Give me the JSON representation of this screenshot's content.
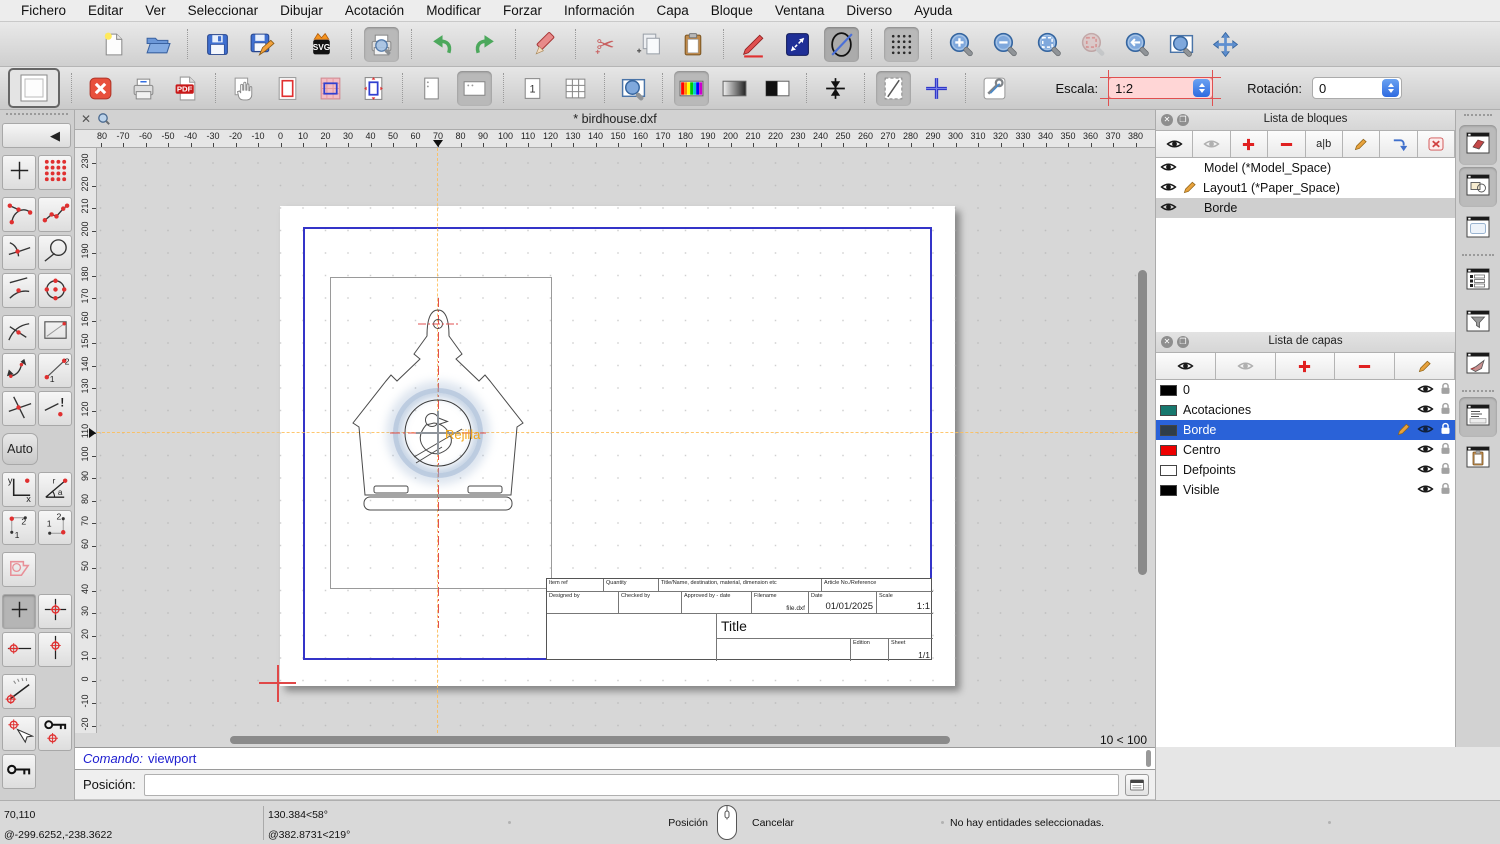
{
  "menu_bar": {
    "items": [
      "Fichero",
      "Editar",
      "Ver",
      "Seleccionar",
      "Dibujar",
      "Acotación",
      "Modificar",
      "Forzar",
      "Información",
      "Capa",
      "Bloque",
      "Ventana",
      "Diverso",
      "Ayuda"
    ]
  },
  "window": {
    "tab_title": "* birdhouse.dxf"
  },
  "toolbars": {
    "scale_label": "Escala:",
    "scale_value": "1:2",
    "rotation_label": "Rotación:",
    "rotation_value": "0",
    "main_buttons": [
      {
        "icon": "new-file"
      },
      {
        "icon": "open-file"
      },
      {
        "sep": true
      },
      {
        "icon": "save"
      },
      {
        "icon": "save-as"
      },
      {
        "sep": true
      },
      {
        "icon": "export-svg"
      },
      {
        "sep": true
      },
      {
        "icon": "print-preview",
        "active": true
      },
      {
        "sep": true
      },
      {
        "icon": "undo"
      },
      {
        "icon": "redo"
      },
      {
        "sep": true
      },
      {
        "icon": "delete-entities"
      },
      {
        "sep": true
      },
      {
        "icon": "cut"
      },
      {
        "icon": "copy"
      },
      {
        "icon": "paste"
      },
      {
        "sep": true
      },
      {
        "icon": "attributes-pencil"
      },
      {
        "icon": "measure-distance"
      },
      {
        "icon": "ellipse-tool",
        "active": true,
        "dark": true
      },
      {
        "sep": true
      },
      {
        "icon": "grid-toggle",
        "active": true
      },
      {
        "sep": true
      },
      {
        "icon": "zoom-in"
      },
      {
        "icon": "zoom-out"
      },
      {
        "icon": "zoom-auto"
      },
      {
        "icon": "zoom-selected",
        "disabled": true
      },
      {
        "icon": "zoom-previous"
      },
      {
        "icon": "zoom-window"
      },
      {
        "icon": "zoom-pan"
      }
    ],
    "layout_buttons": [
      {
        "icon": "layout-mode",
        "framed": true
      },
      {
        "sep": true
      },
      {
        "icon": "close-drawing"
      },
      {
        "icon": "print-export"
      },
      {
        "icon": "pdf-export"
      },
      {
        "sep": true
      },
      {
        "icon": "drag-page"
      },
      {
        "icon": "page-border"
      },
      {
        "icon": "hatch-area"
      },
      {
        "icon": "viewport-fit"
      },
      {
        "sep": true
      },
      {
        "icon": "page-portrait"
      },
      {
        "icon": "page-landscape",
        "active": true
      },
      {
        "sep": true
      },
      {
        "icon": "single-page"
      },
      {
        "icon": "multi-page"
      },
      {
        "sep": true
      },
      {
        "icon": "zoom-window2"
      },
      {
        "sep": true
      },
      {
        "icon": "color-mode",
        "active": true
      },
      {
        "icon": "grayscale-mode"
      },
      {
        "icon": "blackwhite-mode"
      },
      {
        "sep": true
      },
      {
        "icon": "center-marks"
      },
      {
        "sep": true
      },
      {
        "icon": "draft-mode",
        "active": true
      },
      {
        "icon": "crosshair-toggle"
      },
      {
        "sep": true
      },
      {
        "icon": "settings-tools"
      }
    ]
  },
  "snap_palette": {
    "auto_label": "Auto",
    "rows": [
      {
        "cells": [
          {
            "icon": "back-arrow",
            "wide": true
          }
        ]
      },
      {
        "cells": [
          {
            "icon": "free-snap"
          },
          {
            "icon": "grid-snap"
          }
        ],
        "gap": true
      },
      {
        "cells": [
          {
            "icon": "endpoint-snap"
          },
          {
            "icon": "entity-snap"
          }
        ],
        "gap": true
      },
      {
        "cells": [
          {
            "icon": "intersection-snap"
          },
          {
            "icon": "circle-snap"
          }
        ]
      },
      {
        "cells": [
          {
            "icon": "nearest-snap"
          },
          {
            "icon": "center-snap"
          }
        ]
      },
      {
        "cells": [
          {
            "icon": "tangent-snap"
          },
          {
            "icon": "reference-snap"
          }
        ],
        "gap": true
      },
      {
        "cells": [
          {
            "icon": "orthogonal-snap"
          },
          {
            "icon": "distance-snap"
          }
        ]
      },
      {
        "cells": [
          {
            "icon": "intersection-manual"
          },
          {
            "icon": "snap-warning"
          }
        ]
      },
      {
        "cells": [
          {
            "icon": "auto-button",
            "auto": true
          }
        ],
        "gap": true
      },
      {
        "cells": [
          {
            "icon": "coordinate-yx"
          },
          {
            "icon": "coordinate-polar"
          }
        ],
        "gap": true
      },
      {
        "cells": [
          {
            "icon": "corner-snap-12"
          },
          {
            "icon": "corner-snap-21"
          }
        ]
      },
      {
        "cells": [
          {
            "icon": "select-region"
          }
        ],
        "gap": true
      },
      {
        "cells": [
          {
            "icon": "restrict-nothing",
            "active": true
          },
          {
            "icon": "restrict-orthogonal"
          }
        ],
        "gap": true
      },
      {
        "cells": [
          {
            "icon": "restrict-horizontal"
          },
          {
            "icon": "restrict-vertical"
          }
        ]
      },
      {
        "cells": [
          {
            "icon": "angle-gauge"
          }
        ],
        "gap": true
      },
      {
        "cells": [
          {
            "icon": "pick-point"
          },
          {
            "icon": "lock-relative-zero"
          }
        ],
        "gap": true
      },
      {
        "cells": [
          {
            "icon": "relative-zero-key"
          }
        ]
      }
    ]
  },
  "rulers": {
    "top": {
      "start": -80,
      "end": 380,
      "step": 10,
      "marker": 70
    },
    "left": {
      "start": 230,
      "end": -20,
      "step": 10,
      "marker": 110
    }
  },
  "canvas": {
    "snap_label": "Rejilla",
    "zoom_ratio": "10 < 100"
  },
  "title_block": {
    "item_ref": "Item ref",
    "quantity": "Quantity",
    "title_name": "Title/Name, destination, material, dimension etc",
    "article": "Article No./Reference",
    "designed": "Designed by",
    "checked": "Checked by",
    "approved": "Approved by - date",
    "filename_label": "Filename",
    "filename_value": "file.dxf",
    "date_label": "Date",
    "date_value": "01/01/2025",
    "scale_label": "Scale",
    "scale_value": "1:1",
    "title": "Title",
    "edition": "Edition",
    "sheet_label": "Sheet",
    "sheet_value": "1/1"
  },
  "block_list": {
    "title": "Lista de bloques",
    "rename_label": "a|b",
    "toolbar": [
      "show-all-blocks",
      "hide-all-blocks",
      "add-block",
      "remove-block",
      "rename-block",
      "edit-block",
      "insert-block",
      "delete-block"
    ],
    "rows": [
      {
        "label": "Model (*Model_Space)",
        "editing": false,
        "selected": false
      },
      {
        "label": "Layout1 (*Paper_Space)",
        "editing": true,
        "selected": false
      },
      {
        "label": "Borde",
        "editing": false,
        "selected": true
      }
    ]
  },
  "layer_list": {
    "title": "Lista de capas",
    "toolbar": [
      "show-all-layers",
      "hide-all-layers",
      "add-layer",
      "remove-layer",
      "edit-layer"
    ],
    "rows": [
      {
        "label": "0",
        "color": "#000000",
        "selected": false,
        "editing": false
      },
      {
        "label": "Acotaciones",
        "color": "#17786E",
        "selected": false,
        "editing": false
      },
      {
        "label": "Borde",
        "color": "#2F3D4A",
        "selected": true,
        "editing": true
      },
      {
        "label": "Centro",
        "color": "#EE0000",
        "selected": false,
        "editing": false
      },
      {
        "label": "Defpoints",
        "color": "#FFFFFF",
        "selected": false,
        "editing": false
      },
      {
        "label": "Visible",
        "color": "#000000",
        "selected": false,
        "editing": false
      }
    ]
  },
  "dock": {
    "buttons": [
      {
        "icon": "block-dock",
        "active": true
      },
      {
        "icon": "library-dock",
        "active": true
      },
      {
        "icon": "preview-dock"
      },
      {
        "sep": true
      },
      {
        "icon": "layerlist-dock"
      },
      {
        "icon": "filter-dock"
      },
      {
        "icon": "pen-dock"
      },
      {
        "sep": true
      },
      {
        "icon": "command-dock",
        "active": true
      },
      {
        "icon": "clipboard-dock"
      }
    ]
  },
  "command_line": {
    "label": "Comando:",
    "value": "viewport"
  },
  "position_bar": {
    "label": "Posición:",
    "value": ""
  },
  "status_bar": {
    "coord_abs": "70,110",
    "coord_rel": "@-299.6252,-238.3622",
    "polar_abs": "130.384<58°",
    "polar_rel": "@382.8731<219°",
    "mouse_left": "Posición",
    "mouse_right": "Cancelar",
    "message": "No hay entidades seleccionadas."
  },
  "badges": {
    "svg": "SVG",
    "pdf": "PDF",
    "page_one": "1"
  },
  "accent_colors": {
    "selection_blue": "#2A62D8",
    "scale_highlight": "#FFD6D6",
    "snap_orange": "#F2A71B",
    "centerline_red": "#E05050",
    "border_blue": "#3434C8"
  }
}
